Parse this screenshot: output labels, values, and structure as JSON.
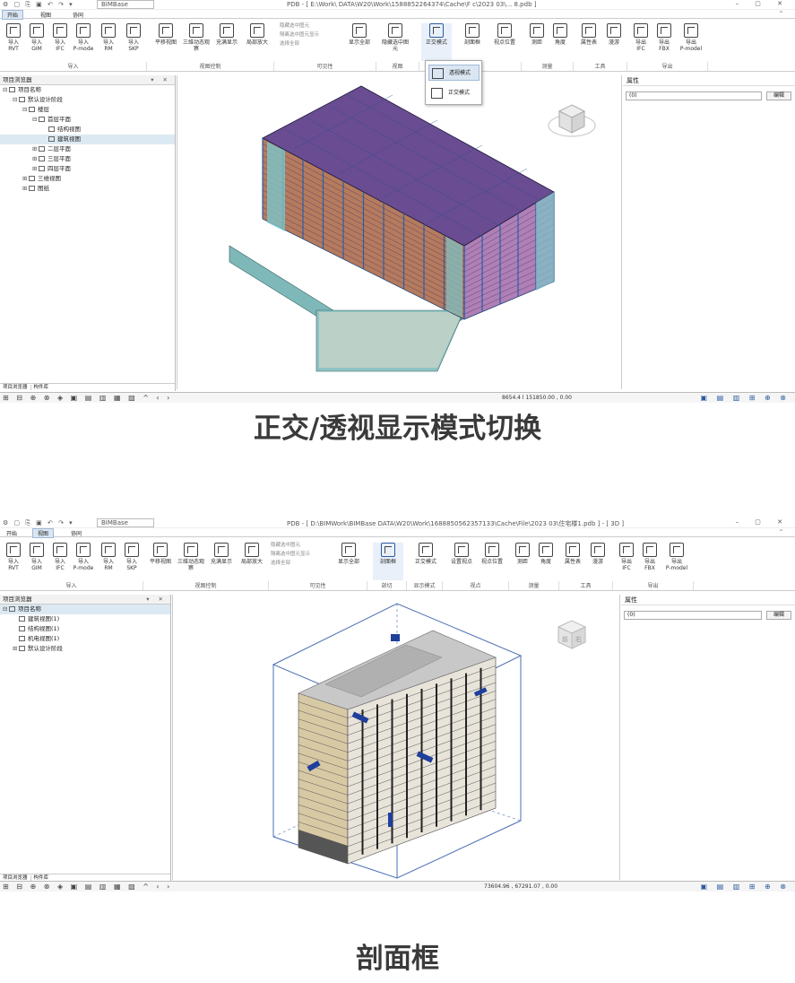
{
  "panel1": {
    "title": "PDB - [ E:\\Work\\ DATA\\W20\\Work\\1588852264374\\Cache\\F c\\2023 03\\... 8.pdb ]",
    "app_selector": "BIMBase",
    "menu": [
      {
        "label": "开始",
        "active": true
      },
      {
        "label": "视图",
        "active": false
      },
      {
        "label": "协同",
        "active": false
      }
    ],
    "ribbon_buttons": [
      {
        "label": "导入\nRVT"
      },
      {
        "label": "导入\nGIM"
      },
      {
        "label": "导入\nIFC"
      },
      {
        "label": "导入\nP-mode"
      },
      {
        "label": "导入\nRM"
      },
      {
        "label": "导入\nSKP"
      },
      {
        "label": "平移视图"
      },
      {
        "label": "三维动态观察"
      },
      {
        "label": "充满显示"
      },
      {
        "label": "局部放大"
      },
      {
        "label": "显示全部"
      },
      {
        "label": "隐藏选中图元"
      },
      {
        "label": "正交模式"
      },
      {
        "label": "剖面框"
      },
      {
        "label": "视点位置"
      },
      {
        "label": "测距"
      },
      {
        "label": "角度"
      },
      {
        "label": "属性表"
      },
      {
        "label": "漫游"
      },
      {
        "label": "导出\nIFC"
      },
      {
        "label": "导出\nFBX"
      },
      {
        "label": "导出\nP-model"
      }
    ],
    "ribbon_mini": [
      "隐藏选中图元",
      "隔离选中图元显示",
      "选择全部"
    ],
    "groups": [
      "导入",
      "视图控制",
      "可见性",
      "视图",
      "显示模式",
      "测量",
      "工具",
      "导出"
    ],
    "dropdown_items": [
      {
        "label": "透视模式",
        "selected": true
      },
      {
        "label": "正交模式",
        "selected": false
      }
    ],
    "left_pane_title": "项目浏览器",
    "tree": [
      {
        "label": "项目名称",
        "depth": 0,
        "exp": "⊟",
        "selected": false
      },
      {
        "label": "默认设计阶段",
        "depth": 1,
        "exp": "⊟",
        "selected": false
      },
      {
        "label": "楼层",
        "depth": 2,
        "exp": "⊟",
        "selected": false
      },
      {
        "label": "首层平面",
        "depth": 3,
        "exp": "⊟",
        "selected": false
      },
      {
        "label": "结构视图",
        "depth": 4,
        "exp": "",
        "selected": false
      },
      {
        "label": "建筑视图",
        "depth": 4,
        "exp": "",
        "selected": true
      },
      {
        "label": "二层平面",
        "depth": 3,
        "exp": "⊞",
        "selected": false
      },
      {
        "label": "三层平面",
        "depth": 3,
        "exp": "⊞",
        "selected": false
      },
      {
        "label": "四层平面",
        "depth": 3,
        "exp": "⊞",
        "selected": false
      },
      {
        "label": "三维视图",
        "depth": 2,
        "exp": "⊞",
        "selected": false
      },
      {
        "label": "图纸",
        "depth": 2,
        "exp": "⊞",
        "selected": false
      }
    ],
    "pane_tabs": [
      "项目浏览器",
      "构件库"
    ],
    "right_pane_title": "属性",
    "prop_select": "(0)",
    "prop_button": "编辑",
    "coords": "8654.4 l  151850.00 , 0.00"
  },
  "panel2": {
    "title": "PDB - [ D:\\BIMWork\\BIMBase DATA\\W20\\Work\\1688850562357133\\Cache\\File\\2023 03\\住宅楼1.pdb ] - [ 3D ]",
    "app_selector": "BIMBase",
    "menu": [
      {
        "label": "开始",
        "active": false
      },
      {
        "label": "视图",
        "active": true
      },
      {
        "label": "协同",
        "active": false
      }
    ],
    "ribbon_buttons": [
      {
        "label": "导入\nRVT"
      },
      {
        "label": "导入\nGIM"
      },
      {
        "label": "导入\nIFC"
      },
      {
        "label": "导入\nP-mode"
      },
      {
        "label": "导入\nRM"
      },
      {
        "label": "导入\nSKP"
      },
      {
        "label": "平移视图"
      },
      {
        "label": "三维动态观察"
      },
      {
        "label": "充满显示"
      },
      {
        "label": "局部放大"
      },
      {
        "label": "显示全部"
      },
      {
        "label": "剖面框"
      },
      {
        "label": "正交模式"
      },
      {
        "label": "设置视点"
      },
      {
        "label": "视点位置"
      },
      {
        "label": "测距"
      },
      {
        "label": "角度"
      },
      {
        "label": "属性表"
      },
      {
        "label": "漫游"
      },
      {
        "label": "导出\nIFC"
      },
      {
        "label": "导出\nFBX"
      },
      {
        "label": "导出\nP-model"
      }
    ],
    "ribbon_mini": [
      "隐藏选中图元",
      "隔离选中图元显示",
      "选择全部"
    ],
    "groups": [
      "导入",
      "视图控制",
      "可见性",
      "剖切",
      "显示模式",
      "视点",
      "测量",
      "工具",
      "导出"
    ],
    "left_pane_title": "项目浏览器",
    "tree": [
      {
        "label": "项目名称",
        "depth": 0,
        "exp": "⊟",
        "selected": true
      },
      {
        "label": "建筑视图(1)",
        "depth": 1,
        "exp": "",
        "selected": false
      },
      {
        "label": "结构视图(1)",
        "depth": 1,
        "exp": "",
        "selected": false
      },
      {
        "label": "机电视图(1)",
        "depth": 1,
        "exp": "",
        "selected": false
      },
      {
        "label": "默认设计阶段",
        "depth": 1,
        "exp": "⊞",
        "selected": false
      }
    ],
    "pane_tabs": [
      "项目浏览器",
      "构件库"
    ],
    "right_pane_title": "属性",
    "prop_select": "(0)",
    "prop_button": "编辑",
    "coords": "73604.96 , 67291.07 , 0.00"
  },
  "captions": {
    "first": "正交/透视显示模式切换",
    "second": "剖面框"
  },
  "navcube_labels": [
    "前",
    "右"
  ]
}
